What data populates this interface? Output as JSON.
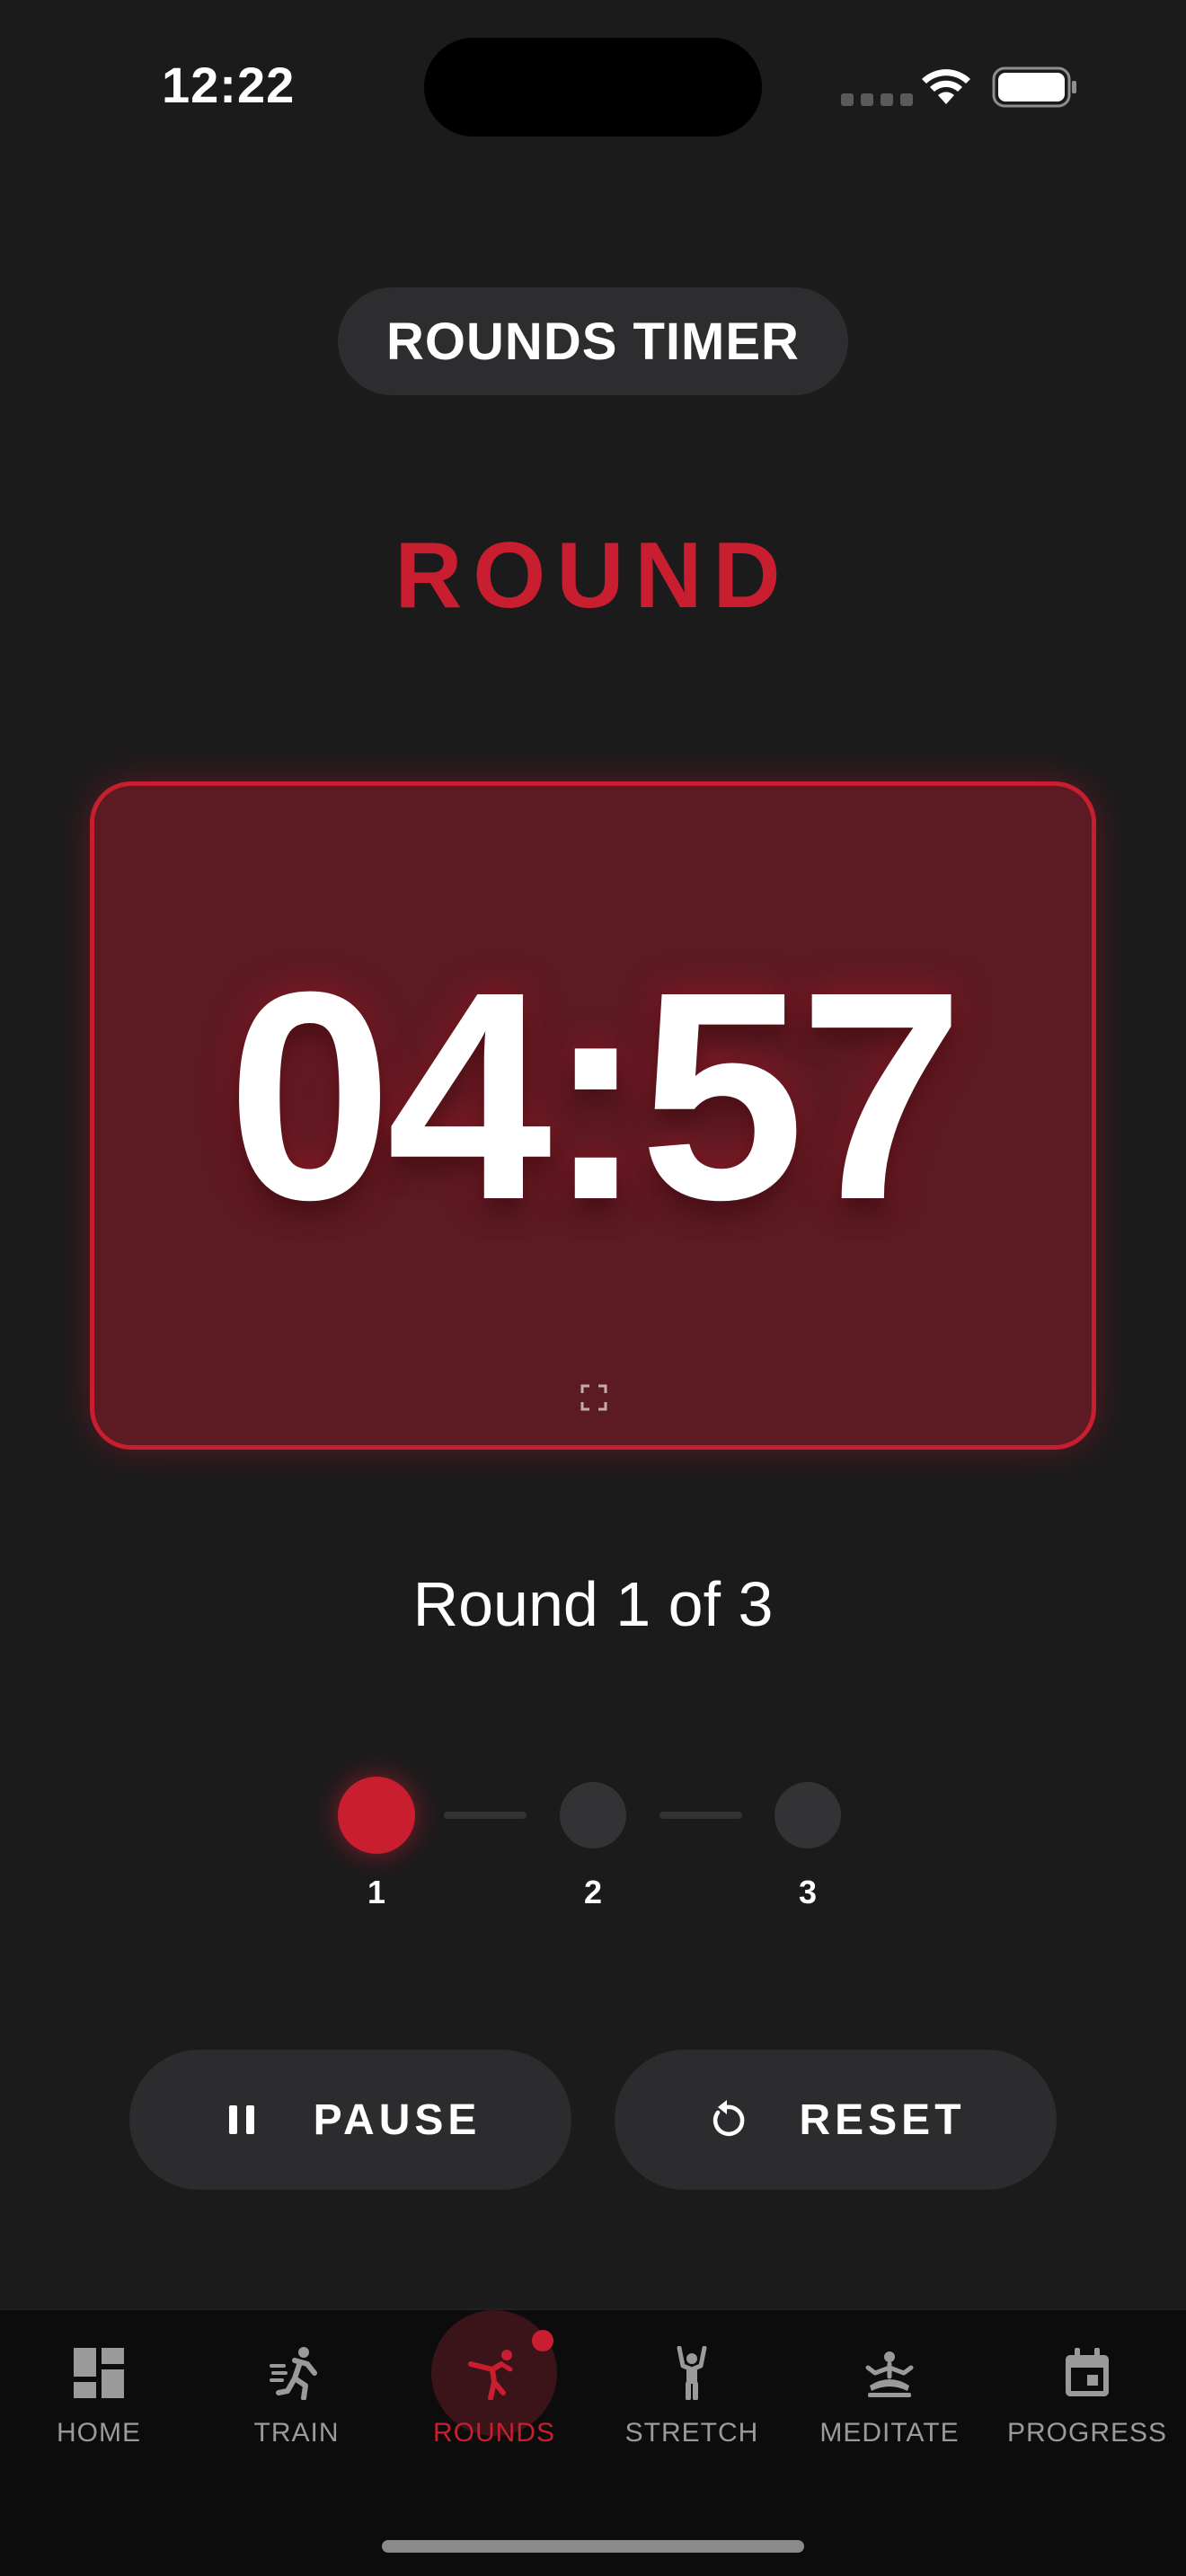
{
  "status_bar": {
    "time": "12:22",
    "icons": [
      "signal-dots-icon",
      "wifi-icon",
      "battery-icon"
    ]
  },
  "header": {
    "title": "ROUNDS TIMER"
  },
  "phase": {
    "label": "ROUND"
  },
  "timer": {
    "display": "04:57",
    "fullscreen_icon": "fullscreen-icon"
  },
  "rounds": {
    "status_text": "Round 1 of 3",
    "current": 1,
    "total": 3,
    "steps": [
      {
        "label": "1",
        "state": "active"
      },
      {
        "label": "2",
        "state": "pending"
      },
      {
        "label": "3",
        "state": "pending"
      }
    ]
  },
  "controls": {
    "pause_label": "PAUSE",
    "pause_icon": "pause-icon",
    "reset_label": "RESET",
    "reset_icon": "reset-icon"
  },
  "nav": {
    "items": [
      {
        "label": "HOME",
        "icon": "dashboard-icon",
        "active": false
      },
      {
        "label": "TRAIN",
        "icon": "running-icon",
        "active": false
      },
      {
        "label": "ROUNDS",
        "icon": "kickboxing-icon",
        "active": true,
        "badge": true
      },
      {
        "label": "STRETCH",
        "icon": "stretching-icon",
        "active": false
      },
      {
        "label": "MEDITATE",
        "icon": "meditation-icon",
        "active": false
      },
      {
        "label": "PROGRESS",
        "icon": "calendar-icon",
        "active": false
      }
    ]
  },
  "colors": {
    "accent": "#c81e2f",
    "background": "#1b1b1c",
    "card": "#5c1a22",
    "pill": "#2d2d2f",
    "nav_background": "#0c0c0d",
    "inactive_nav": "#9a9a9c"
  }
}
